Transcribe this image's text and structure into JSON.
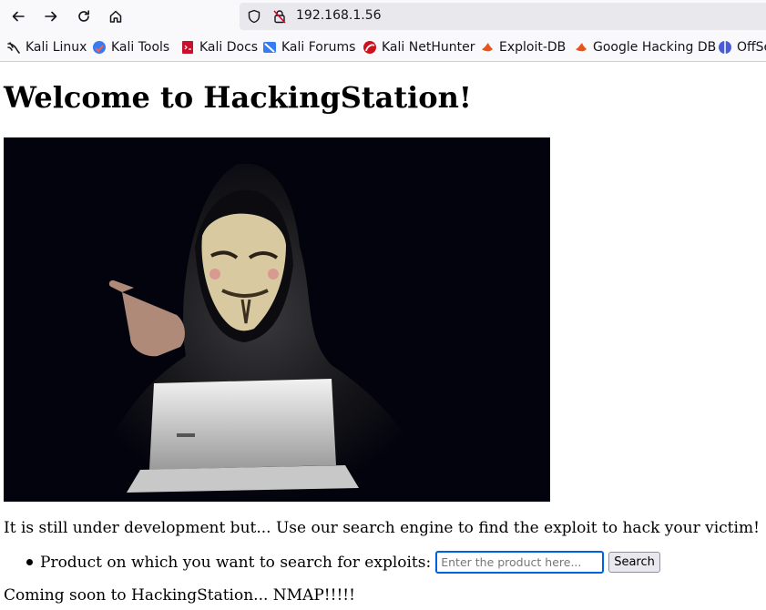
{
  "browser": {
    "url": "192.168.1.56",
    "bookmarks": [
      {
        "label": "Kali Linux",
        "icon": "kali-dragon-icon"
      },
      {
        "label": "Kali Tools",
        "icon": "kali-tools-icon"
      },
      {
        "label": "Kali Docs",
        "icon": "kali-docs-icon"
      },
      {
        "label": "Kali Forums",
        "icon": "kali-forums-icon"
      },
      {
        "label": "Kali NetHunter",
        "icon": "kali-nethunter-icon"
      },
      {
        "label": "Exploit-DB",
        "icon": "exploit-db-icon"
      },
      {
        "label": "Google Hacking DB",
        "icon": "ghdb-icon"
      },
      {
        "label": "OffSe",
        "icon": "offsec-icon"
      }
    ]
  },
  "page": {
    "title": "Welcome to HackingStation!",
    "hero_image": "hooded figure wearing Guy Fawkes mask pointing, with laptop",
    "dev_text": "It is still under development but... Use our search engine to find the exploit to hack your victim!",
    "search": {
      "label": "Product on which you want to search for exploits:",
      "placeholder": "Enter the product here...",
      "button_label": "Search"
    },
    "footer_text": "Coming soon to HackingStation... NMAP!!!!!"
  }
}
